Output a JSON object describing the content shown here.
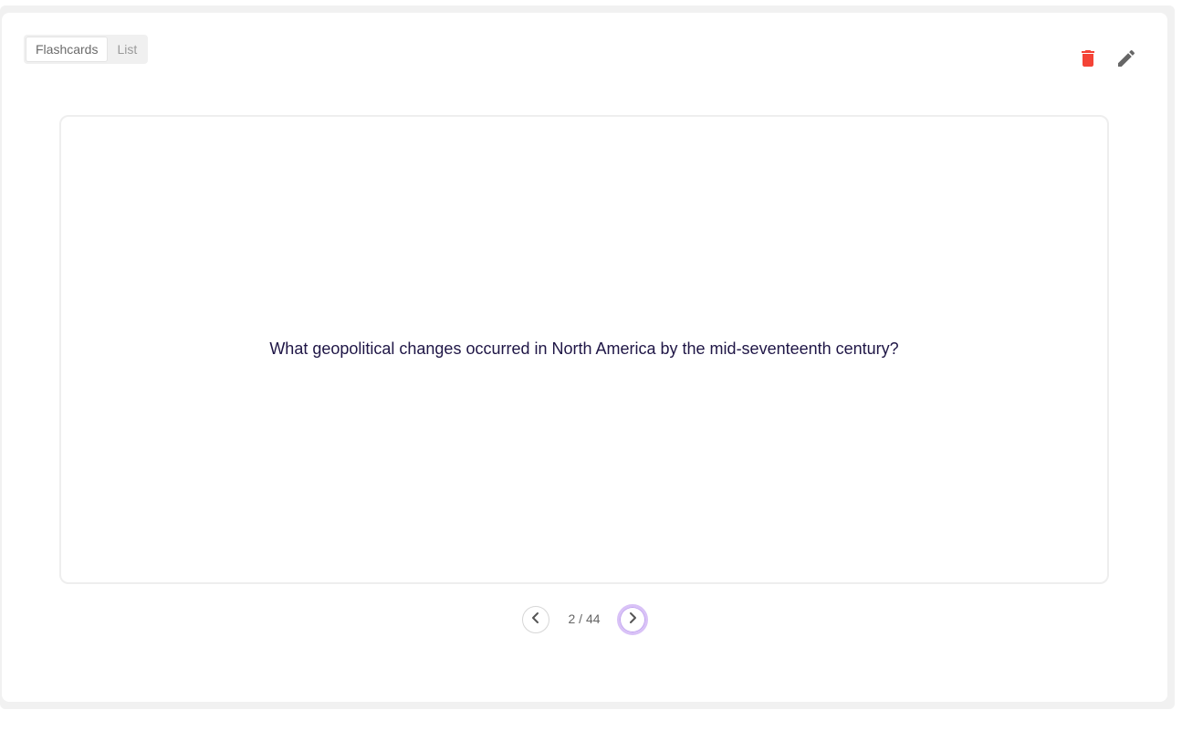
{
  "view_toggle": {
    "options": [
      {
        "label": "Flashcards",
        "active": true
      },
      {
        "label": "List",
        "active": false
      }
    ]
  },
  "actions": {
    "delete_icon": "trash-icon",
    "edit_icon": "pencil-icon",
    "delete_color": "#f44336",
    "edit_color": "#666666"
  },
  "card": {
    "text": "What geopolitical changes occurred in North America by the mid-seventeenth century?"
  },
  "pager": {
    "counter": "2 / 44",
    "prev_icon": "chevron-left-icon",
    "next_icon": "chevron-right-icon"
  }
}
